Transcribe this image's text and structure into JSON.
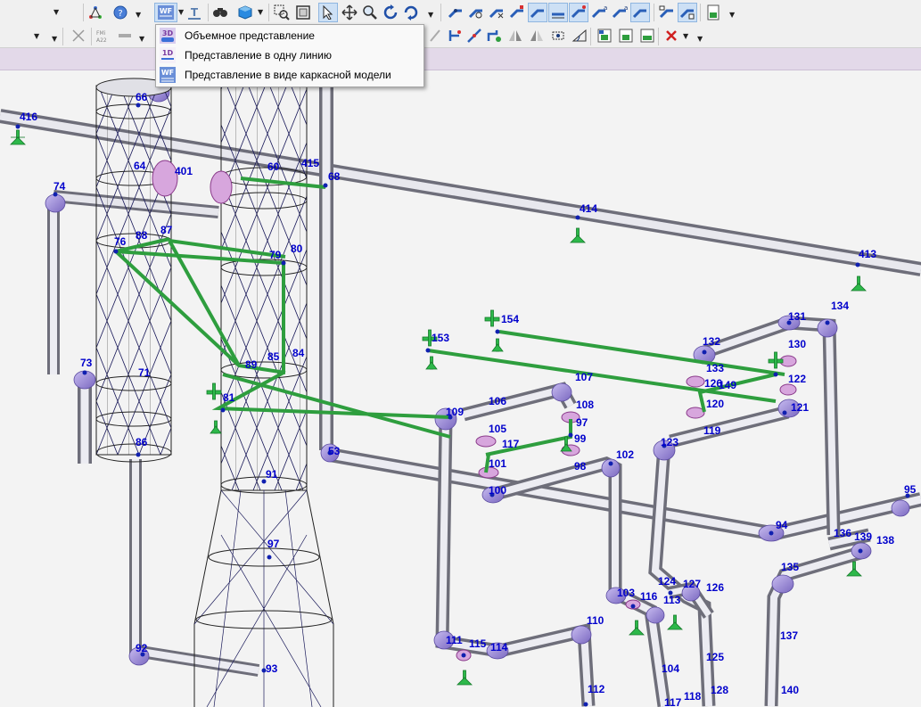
{
  "toolbar": {
    "view_mode_button_icon": "WF",
    "top_buttons": [
      "coord-icon",
      "help-icon",
      "wireframe-view-icon",
      "text-icon",
      "find-icon",
      "cube-icon",
      "zoom-window-icon",
      "zoom-extents-icon",
      "select-icon",
      "pan-icon",
      "zoom-icon",
      "rotate-icon",
      "orbit-icon",
      "pipe-tool-icon",
      "fitting-icon",
      "valve-icon",
      "flange-icon",
      "support-icon",
      "insulation-icon",
      "weld-icon",
      "component-icon",
      "route-icon",
      "edit-icon",
      "report-icon"
    ],
    "bottom_buttons": [
      "layer-icon",
      "disabled-icon",
      "formula-icon",
      "line-icon",
      "align-icon",
      "node-icon",
      "split-icon",
      "join-icon",
      "mirror-icon",
      "rotate-node-icon",
      "measure-icon",
      "angle-icon",
      "add-node-icon",
      "properties-icon",
      "delete-icon"
    ],
    "formula_label": "FMi\nA22"
  },
  "view_menu": {
    "items": [
      {
        "icon": "3D",
        "label": "Объемное представление"
      },
      {
        "icon": "1D",
        "label": "Представление в одну линию"
      },
      {
        "icon": "WF",
        "label": "Представление в виде каркасной модели"
      }
    ]
  },
  "node_labels": [
    "416",
    "74",
    "66",
    "64",
    "401",
    "415",
    "68",
    "60",
    "414",
    "413",
    "76",
    "88",
    "87",
    "80",
    "79",
    "73",
    "71",
    "86",
    "89",
    "85",
    "84",
    "81",
    "134",
    "131",
    "132",
    "130",
    "154",
    "153",
    "107",
    "133",
    "126",
    "149",
    "122",
    "120",
    "121",
    "106",
    "108",
    "109",
    "105",
    "97",
    "99",
    "117",
    "119",
    "123",
    "101",
    "98",
    "102",
    "100",
    "53",
    "91",
    "95",
    "94",
    "136",
    "139",
    "138",
    "135",
    "97",
    "103",
    "116",
    "124",
    "127",
    "126",
    "113",
    "110",
    "92",
    "111",
    "115",
    "114",
    "137",
    "93",
    "104",
    "125",
    "112",
    "118",
    "128",
    "117",
    "140"
  ],
  "colors": {
    "pipe": "#c8c8d0",
    "elbow": "#a89ad8",
    "node_label": "#0000cc",
    "wireframe_dark": "#1a1a4a",
    "structure_green": "#2e9e3e",
    "support_green": "#2db84a",
    "menu_bg": "#f9f9f9",
    "header_band": "#e3d9e9"
  }
}
